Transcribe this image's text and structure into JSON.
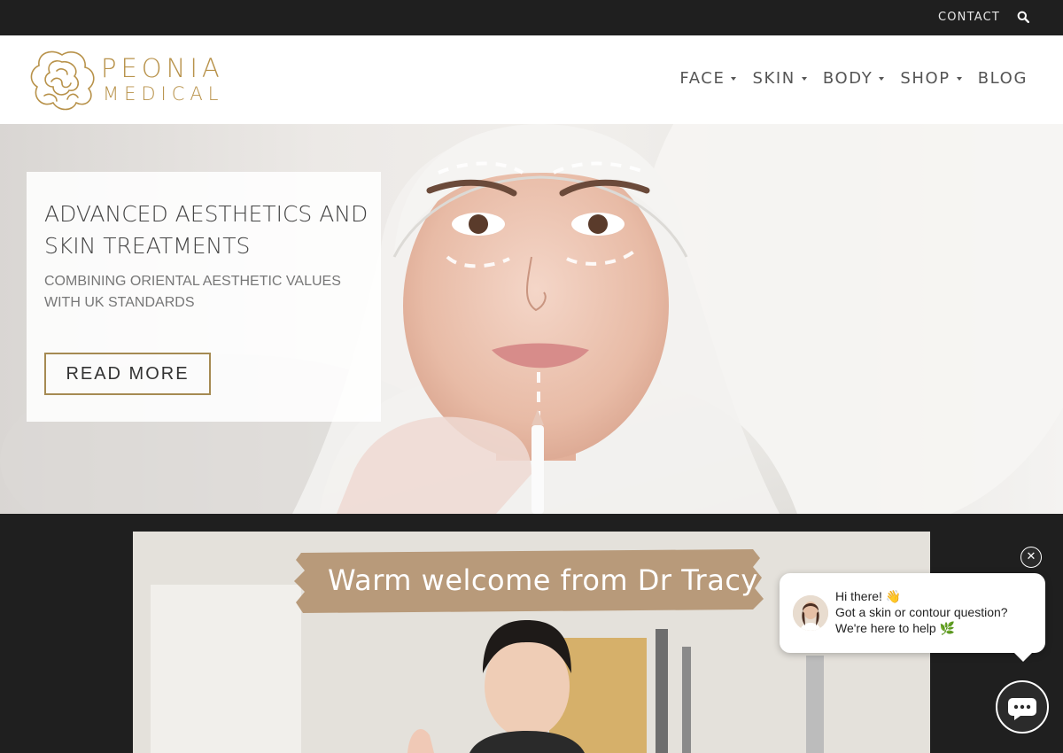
{
  "topbar": {
    "contact_label": "CONTACT",
    "search_icon": "search-icon"
  },
  "brand": {
    "line1": "PEONIA",
    "line2": "MEDICAL",
    "color": "#b8924a"
  },
  "nav": {
    "items": [
      {
        "label": "FACE",
        "has_dropdown": true
      },
      {
        "label": "SKIN",
        "has_dropdown": true
      },
      {
        "label": "BODY",
        "has_dropdown": true
      },
      {
        "label": "SHOP",
        "has_dropdown": true
      },
      {
        "label": "BLOG",
        "has_dropdown": false
      }
    ]
  },
  "hero": {
    "title": "ADVANCED AESTHETICS AND SKIN TREATMENTS",
    "subtitle": "COMBINING ORIENTAL AESTHETIC VALUES WITH UK STANDARDS",
    "button_label": "READ MORE",
    "button_border_color": "#a58a52"
  },
  "video": {
    "caption": "Warm welcome from Dr Tracy"
  },
  "chat": {
    "close_icon": "close-icon",
    "line1": "Hi there! 👋",
    "line2": "Got a skin or contour question?",
    "line3": "We're here to help 🌿",
    "launcher_icon": "chat-bubble-icon"
  },
  "colors": {
    "dark_bg": "#1f1f1f",
    "accent_gold": "#b8924a"
  }
}
